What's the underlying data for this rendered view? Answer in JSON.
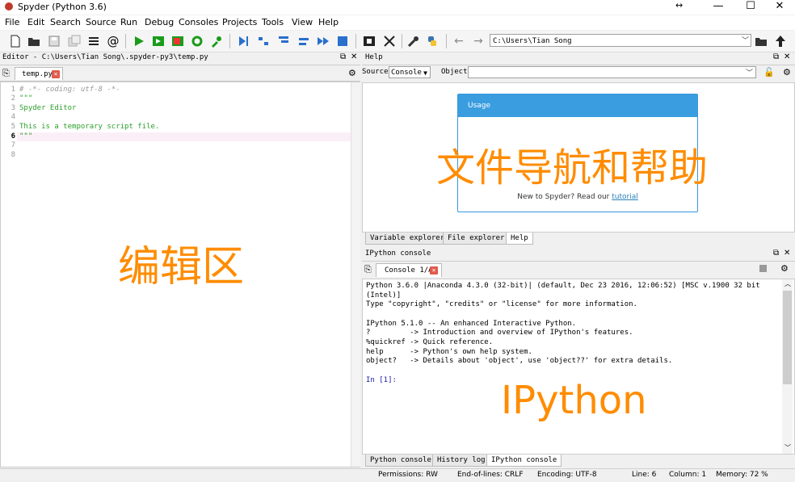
{
  "window": {
    "title": "Spyder (Python 3.6)"
  },
  "menu": [
    "File",
    "Edit",
    "Search",
    "Source",
    "Run",
    "Debug",
    "Consoles",
    "Projects",
    "Tools",
    "View",
    "Help"
  ],
  "toolbar": {
    "path": "C:\\Users\\Tian Song"
  },
  "editor": {
    "pane_title": "Editor - C:\\Users\\Tian Song\\.spyder-py3\\temp.py",
    "tab": "temp.py",
    "current_line": 6,
    "lines": [
      {
        "n": "1",
        "text": "# -*- coding: utf-8 -*-"
      },
      {
        "n": "2",
        "text": "\"\"\""
      },
      {
        "n": "3",
        "text": "Spyder Editor"
      },
      {
        "n": "4",
        "text": ""
      },
      {
        "n": "5",
        "text": "This is a temporary script file."
      },
      {
        "n": "6",
        "text": "\"\"\""
      },
      {
        "n": "7",
        "text": ""
      },
      {
        "n": "8",
        "text": ""
      }
    ]
  },
  "help": {
    "pane_title": "Help",
    "source_label": "Source",
    "source_value": "Console",
    "object_label": "Object",
    "usage_title": "Usage",
    "usage_footer_text": "New to Spyder? Read our",
    "usage_footer_link": "tutorial",
    "tabs": [
      "Variable explorer",
      "File explorer",
      "Help"
    ]
  },
  "ipython": {
    "pane_title": "IPython console",
    "tab": "Console 1/A",
    "lines": [
      "Python 3.6.0 |Anaconda 4.3.0 (32-bit)| (default, Dec 23 2016, 12:06:52) [MSC v.1900 32 bit",
      "(Intel)]",
      "Type \"copyright\", \"credits\" or \"license\" for more information.",
      "",
      "IPython 5.1.0 -- An enhanced Interactive Python.",
      "?         -> Introduction and overview of IPython's features.",
      "%quickref -> Quick reference.",
      "help      -> Python's own help system.",
      "object?   -> Details about 'object', use 'object??' for extra details.",
      "",
      "In [1]:"
    ],
    "tabs": [
      "Python console",
      "History log",
      "IPython console"
    ]
  },
  "status": {
    "permissions": "Permissions: RW",
    "eol": "End-of-lines: CRLF",
    "encoding": "Encoding: UTF-8",
    "line": "Line: 6",
    "column": "Column: 1",
    "memory": "Memory: 72 %"
  },
  "captions": {
    "help_area": "文件导航和帮助",
    "editor_area": "编辑区",
    "console_area": "IPython"
  },
  "colors": {
    "accent": "#3a9de0",
    "caption": "#ff8c00",
    "code": "#2ca02c",
    "comment": "#999999"
  }
}
